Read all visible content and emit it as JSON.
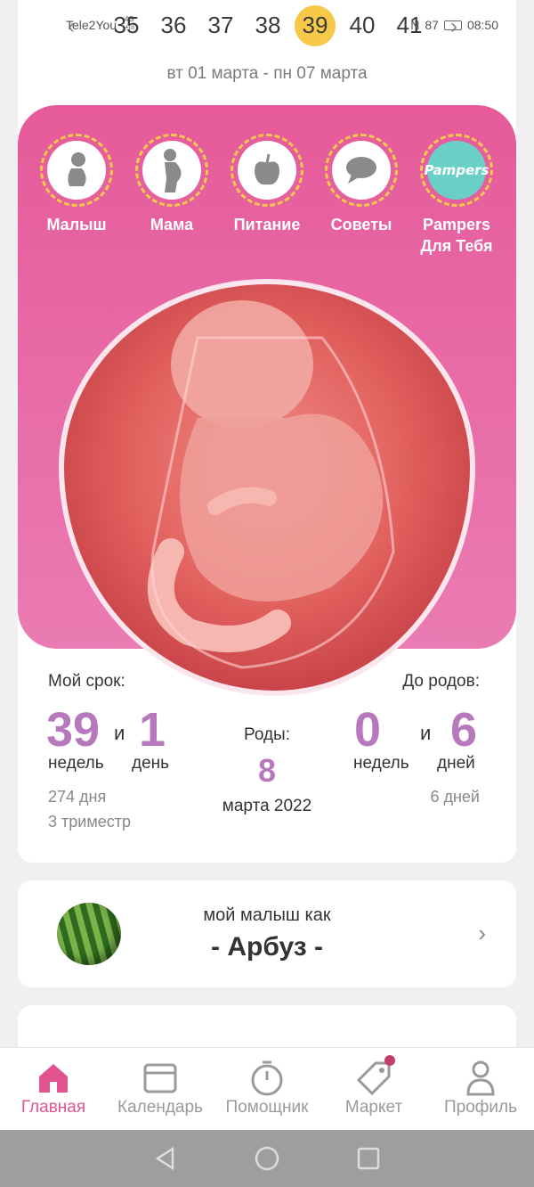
{
  "status_bar": {
    "carrier": "Tele2You",
    "network": "4G",
    "network_sub": "+ııl",
    "nfc": "N",
    "battery": "87",
    "time": "08:50"
  },
  "weeks": {
    "items": [
      "35",
      "36",
      "37",
      "38",
      "39",
      "40",
      "41"
    ],
    "active": "39",
    "prev_icon": "chevron-left-icon",
    "next_icon": "chevron-right-icon"
  },
  "date_range": "вт 01 марта - пн 07 марта",
  "categories": [
    {
      "label": "Малыш",
      "icon": "baby-icon"
    },
    {
      "label": "Мама",
      "icon": "pregnant-mother-icon"
    },
    {
      "label": "Питание",
      "icon": "apple-icon"
    },
    {
      "label": "Советы",
      "icon": "chat-bubble-icon"
    },
    {
      "label": "Pampers\nДля Тебя",
      "line1": "Pampers",
      "line2": "Для Тебя",
      "logo_text": "Pampers"
    }
  ],
  "stats": {
    "my_term_label": "Мой срок:",
    "weeks_value": "39",
    "and1": "и",
    "days_value": "1",
    "weeks_unit": "недель",
    "days_unit": "день",
    "total_days": "274 дня",
    "trimester": "3 триместр",
    "birth_label": "Роды:",
    "birth_day": "8",
    "birth_month_year": "марта 2022",
    "until_label": "До родов:",
    "until_weeks": "0",
    "and2": "и",
    "until_days": "6",
    "until_weeks_unit": "недель",
    "until_days_unit": "дней",
    "until_total": "6 дней"
  },
  "size_card": {
    "title": "мой малыш как",
    "fruit": "- Арбуз -"
  },
  "bottom_nav": [
    {
      "label": "Главная",
      "icon": "home-icon",
      "active": true
    },
    {
      "label": "Календарь",
      "icon": "calendar-icon"
    },
    {
      "label": "Помощник",
      "icon": "timer-icon"
    },
    {
      "label": "Маркет",
      "icon": "tag-icon",
      "badge": true
    },
    {
      "label": "Профиль",
      "icon": "profile-icon"
    }
  ],
  "colors": {
    "accent_pink": "#e65a9a",
    "nav_active": "#e0558f",
    "numbers_purple": "#b778be",
    "week_highlight": "#f7c948"
  }
}
